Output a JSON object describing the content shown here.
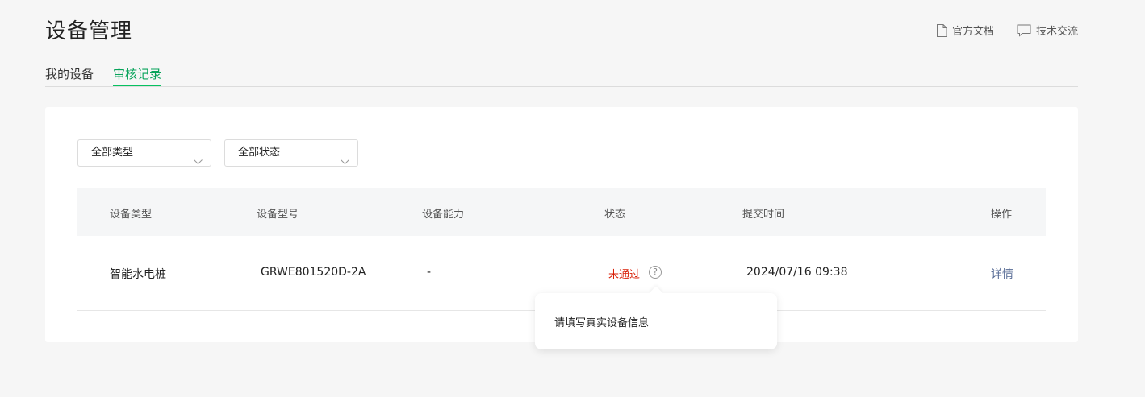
{
  "header": {
    "title": "设备管理",
    "links": [
      {
        "label": "官方文档",
        "icon": "document-icon"
      },
      {
        "label": "技术交流",
        "icon": "chat-icon"
      }
    ]
  },
  "tabs": [
    {
      "label": "我的设备",
      "active": false
    },
    {
      "label": "审核记录",
      "active": true
    }
  ],
  "filters": {
    "type_select": "全部类型",
    "status_select": "全部状态"
  },
  "table": {
    "columns": [
      "设备类型",
      "设备型号",
      "设备能力",
      "状态",
      "提交时间",
      "操作"
    ],
    "rows": [
      {
        "type": "智能水电桩",
        "model": "GRWE801520D-2A",
        "capability": "-",
        "status": "未通过",
        "submitted": "2024/07/16 09:38",
        "action": "详情"
      }
    ]
  },
  "tooltip": {
    "text": "请填写真实设备信息"
  },
  "colors": {
    "accent": "#07c160",
    "failed": "#d81e06",
    "link": "#576b95"
  }
}
